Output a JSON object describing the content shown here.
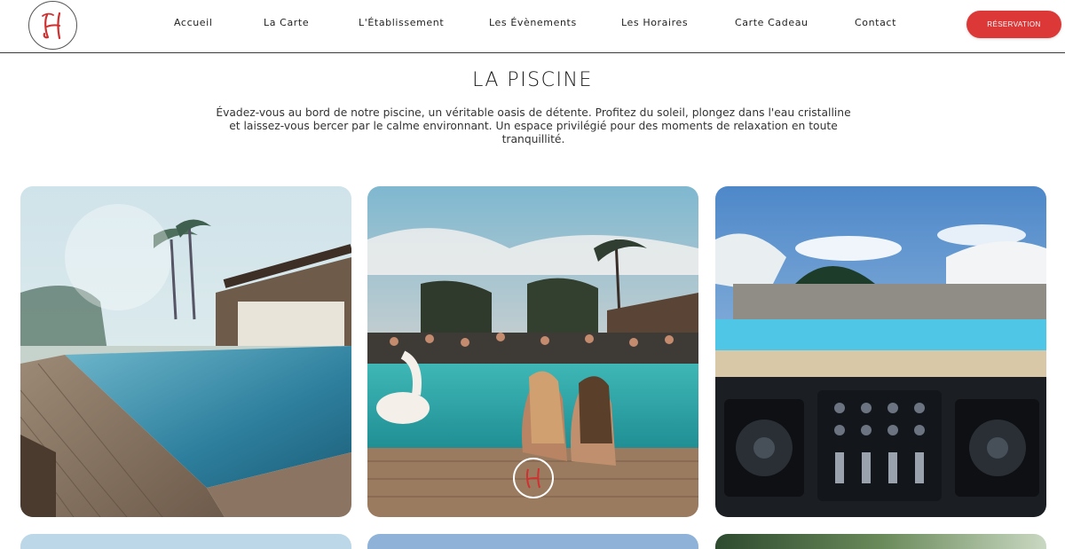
{
  "header": {
    "logo_alt": "H",
    "nav": [
      {
        "label": "Accueil"
      },
      {
        "label": "La Carte"
      },
      {
        "label": "L'Établissement"
      },
      {
        "label": "Les Évènements"
      },
      {
        "label": "Les Horaires"
      },
      {
        "label": "Carte Cadeau"
      },
      {
        "label": "Contact"
      }
    ],
    "reserve_label": "RÉSERVATION"
  },
  "main": {
    "title": "LA PISCINE",
    "intro": "Évadez-vous au bord de notre piscine, un véritable oasis de détente. Profitez du soleil, plongez dans l'eau cristalline et laissez-vous bercer par le calme environnant. Un espace privilégié pour des moments de relaxation en toute tranquillité."
  },
  "colors": {
    "accent": "#dd3838",
    "divider": "#3a3a3a"
  }
}
